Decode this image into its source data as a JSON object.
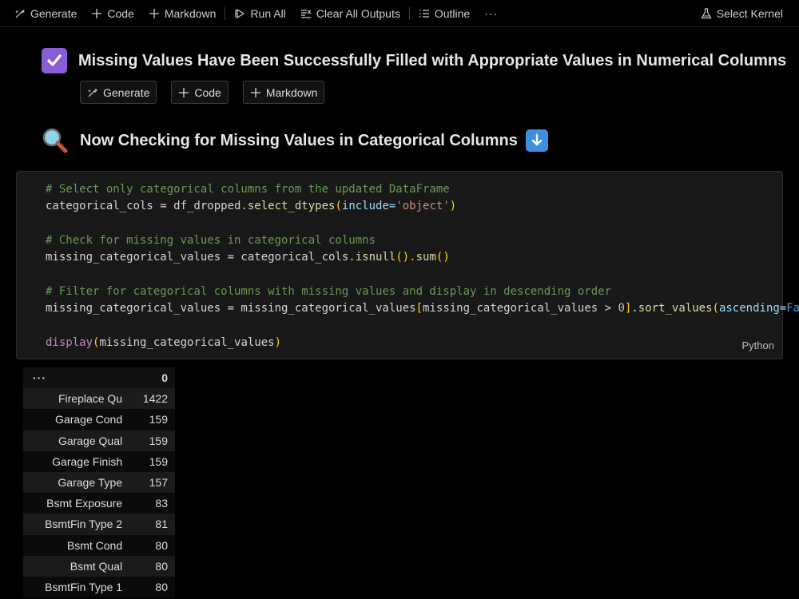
{
  "toolbar": {
    "generate": "Generate",
    "code": "Code",
    "markdown": "Markdown",
    "run_all": "Run All",
    "clear_outputs": "Clear All Outputs",
    "outline": "Outline",
    "more": "···",
    "select_kernel": "Select Kernel"
  },
  "heading1": {
    "text": "Missing Values Have Been Successfully Filled with Appropriate Values in Numerical Columns",
    "icon": "check-box-icon"
  },
  "cell_toolbar": {
    "generate": "Generate",
    "code": "Code",
    "markdown": "Markdown"
  },
  "heading2": {
    "text": "Now Checking for Missing Values in Categorical Columns",
    "icon_left": "magnifier-icon",
    "icon_right": "down-arrow-icon"
  },
  "code_cell": {
    "language": "Python",
    "lines": {
      "l1": "# Select only categorical columns from the updated DataFrame",
      "l2a": "categorical_cols = df_dropped.",
      "l2b": "select_dtypes",
      "l2c": "(",
      "l2d": "include=",
      "l2e": "'object'",
      "l2f": ")",
      "l3": "# Check for missing values in categorical columns",
      "l4a": "missing_categorical_values = categorical_cols.",
      "l4b": "isnull",
      "l4c": "().",
      "l4d": "sum",
      "l4e": "()",
      "l5": "# Filter for categorical columns with missing values and display in descending order",
      "l6a": "missing_categorical_values = missing_categorical_values",
      "l6b": "[",
      "l6c": "missing_categorical_values > ",
      "l6d": "0",
      "l6e": "]",
      "l6f": ".",
      "l6g": "sort_values",
      "l6h": "(",
      "l6i": "ascending",
      "l6j": "=",
      "l6k": "False",
      "l6l": ")",
      "l7a": "display",
      "l7b": "(",
      "l7c": "missing_categorical_values",
      "l7d": ")"
    }
  },
  "output_table": {
    "index_header": "···",
    "value_header": "0",
    "rows": [
      {
        "name": "Fireplace Qu",
        "value": "1422"
      },
      {
        "name": "Garage Cond",
        "value": "159"
      },
      {
        "name": "Garage Qual",
        "value": "159"
      },
      {
        "name": "Garage Finish",
        "value": "159"
      },
      {
        "name": "Garage Type",
        "value": "157"
      },
      {
        "name": "Bsmt Exposure",
        "value": "83"
      },
      {
        "name": "BsmtFin Type 2",
        "value": "81"
      },
      {
        "name": "Bsmt Cond",
        "value": "80"
      },
      {
        "name": "Bsmt Qual",
        "value": "80"
      },
      {
        "name": "BsmtFin Type 1",
        "value": "80"
      }
    ]
  }
}
